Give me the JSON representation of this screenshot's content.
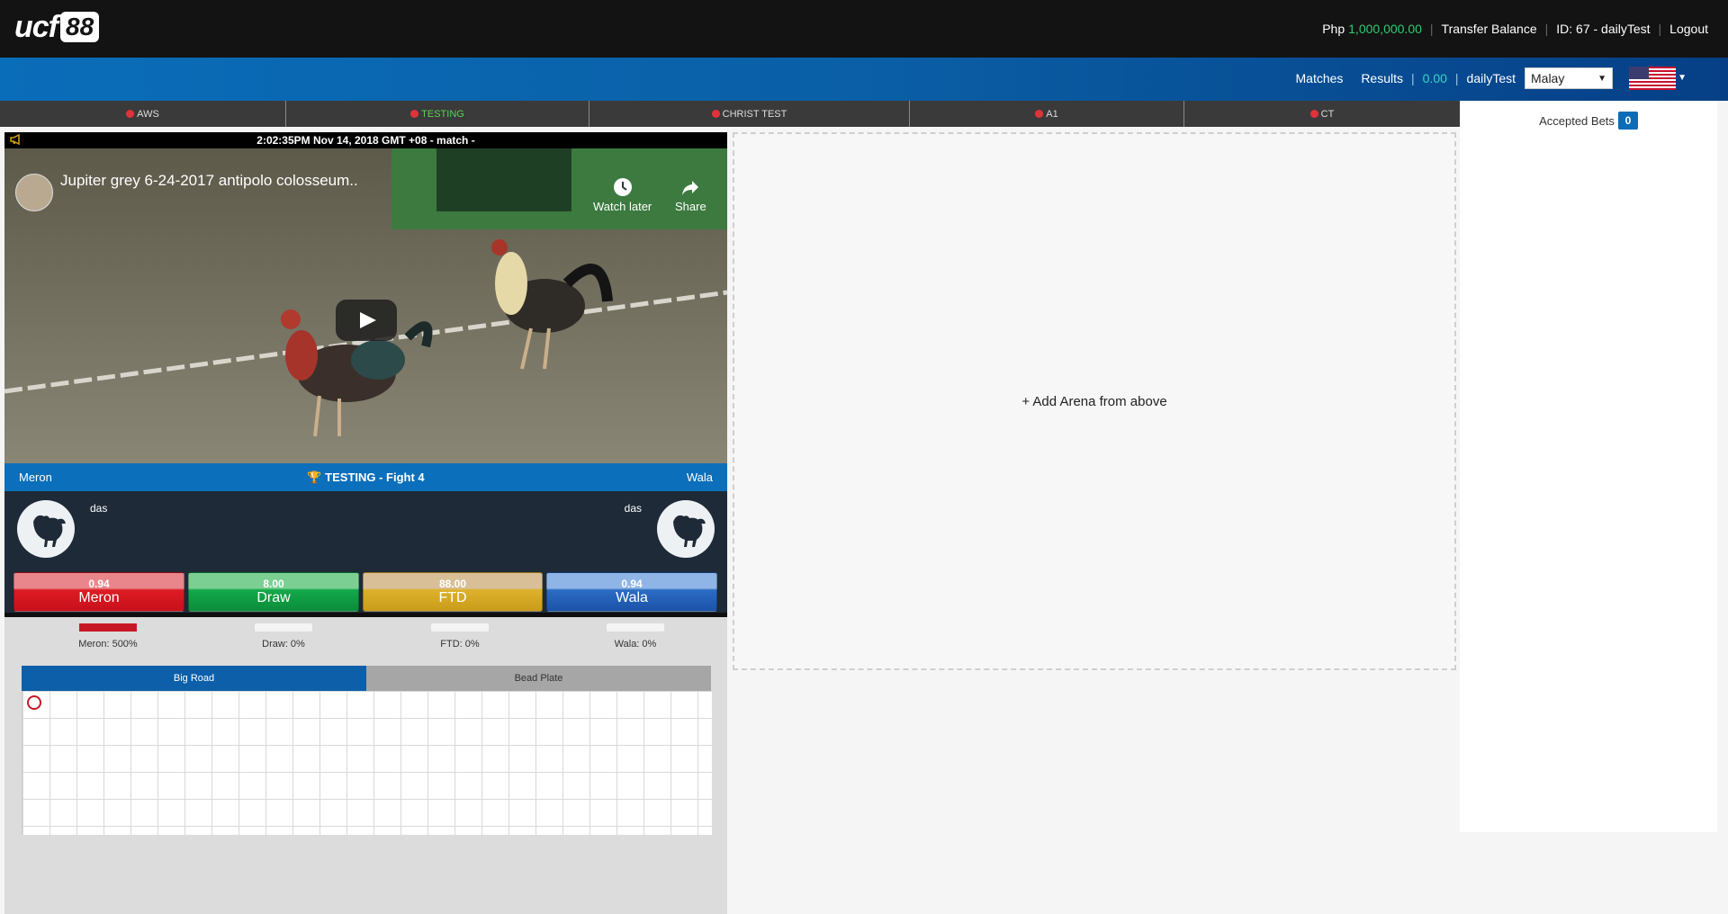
{
  "brand": {
    "logo_text": "ucf",
    "logo_number": "88"
  },
  "topbar": {
    "currency": "Php",
    "balance": "1,000,000.00",
    "transfer_label": "Transfer Balance",
    "id_label": "ID: 67 - dailyTest",
    "logout_label": "Logout"
  },
  "navbar": {
    "matches_label": "Matches",
    "results_label": "Results",
    "balance": "0.00",
    "username": "dailyTest",
    "language": "Malay",
    "flag": "us-flag-icon"
  },
  "arenas": [
    {
      "label": "AWS",
      "active": false
    },
    {
      "label": "TESTING",
      "active": true
    },
    {
      "label": "CHRIST TEST",
      "active": false
    },
    {
      "label": "A1",
      "active": false
    },
    {
      "label": "CT",
      "active": false
    }
  ],
  "video": {
    "header": "2:02:35PM Nov 14, 2018 GMT +08 - match -",
    "title": "Jupiter grey 6-24-2017 antipolo colosseum..",
    "watch_later": "Watch later",
    "share": "Share"
  },
  "fight": {
    "left_label": "Meron",
    "title": "TESTING - Fight 4",
    "right_label": "Wala",
    "left_name": "das",
    "right_name": "das"
  },
  "bets": [
    {
      "odds": "0.94",
      "label": "Meron"
    },
    {
      "odds": "8.00",
      "label": "Draw"
    },
    {
      "odds": "88.00",
      "label": "FTD"
    },
    {
      "odds": "0.94",
      "label": "Wala"
    }
  ],
  "stats": [
    {
      "label": "Meron: 500%",
      "percent": 500
    },
    {
      "label": "Draw: 0%",
      "percent": 0
    },
    {
      "label": "FTD: 0%",
      "percent": 0
    },
    {
      "label": "Wala: 0%",
      "percent": 0
    }
  ],
  "road_tabs": {
    "big_road": "Big Road",
    "bead_plate": "Bead Plate"
  },
  "arena_panel": {
    "add_label": "+ Add Arena from above"
  },
  "sidebar": {
    "accepted_label": "Accepted Bets",
    "accepted_count": "0"
  }
}
